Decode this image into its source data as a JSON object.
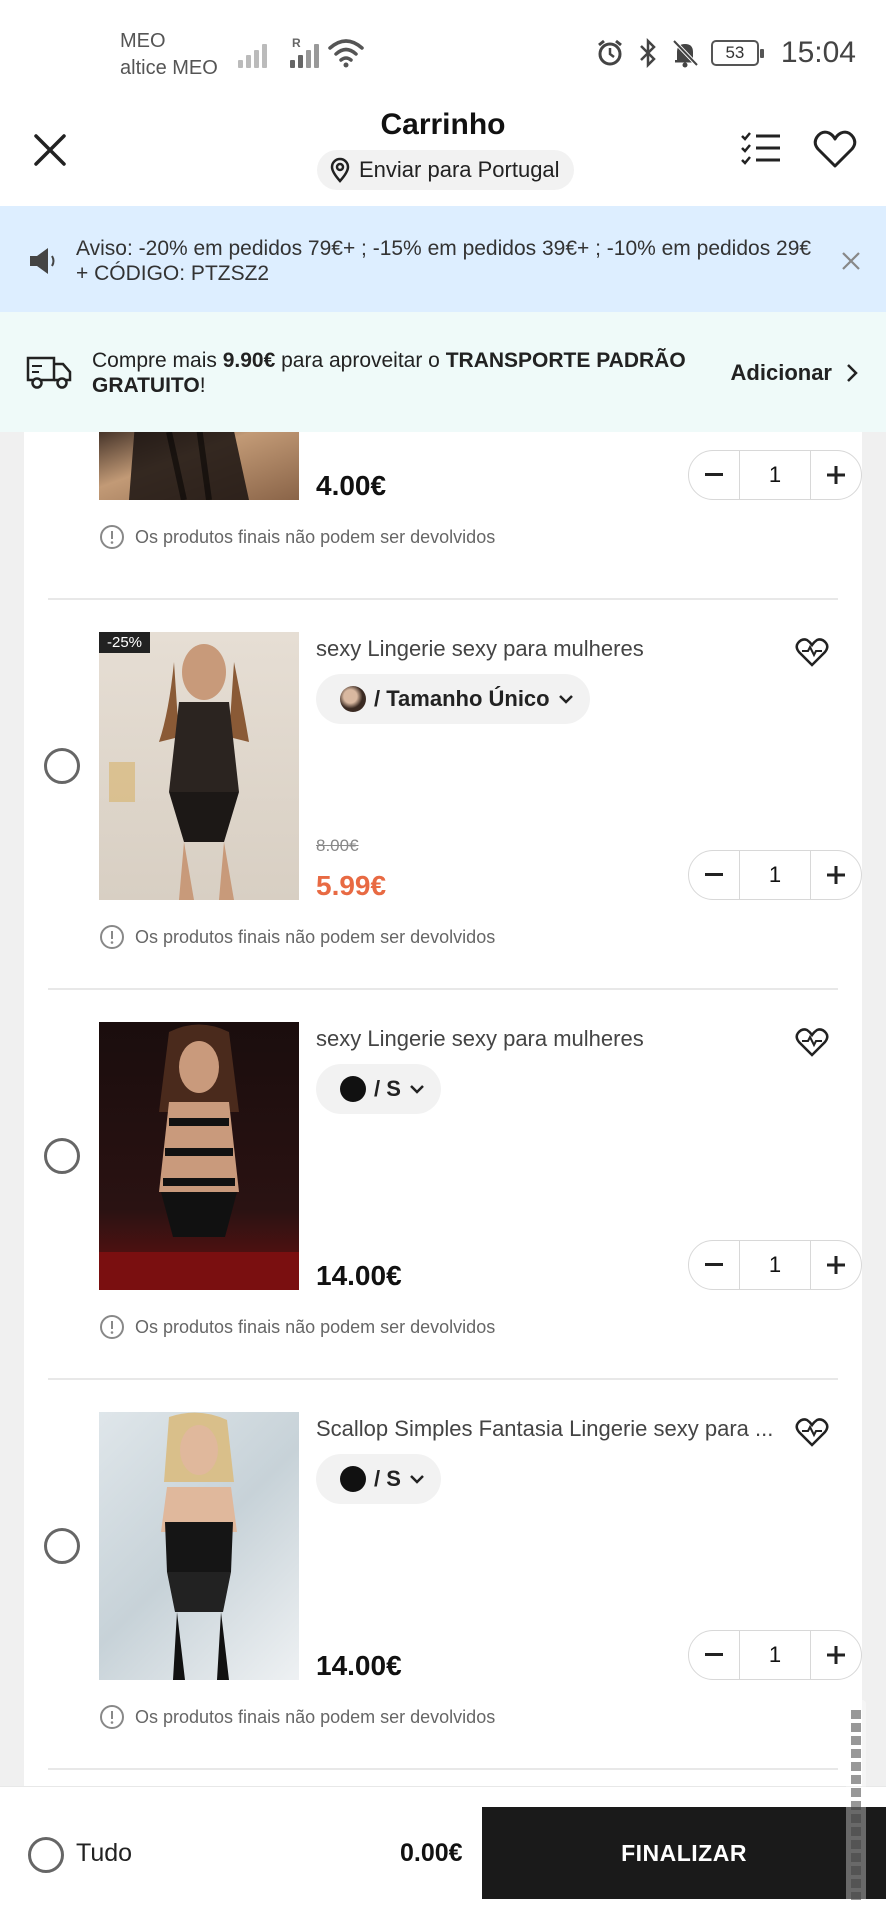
{
  "status_bar": {
    "carrier_line1": "MEO",
    "carrier_line2": "altice MEO",
    "roaming": "R",
    "battery": "53",
    "time": "15:04",
    "icons": [
      "signal-icon",
      "wifi-icon",
      "alarm-icon",
      "bluetooth-icon",
      "bell-muted-icon",
      "battery-icon"
    ]
  },
  "header": {
    "title": "Carrinho",
    "ship_to": "Enviar para Portugal",
    "icons": [
      "close-icon",
      "location-pin-icon",
      "checklist-icon",
      "heart-icon"
    ]
  },
  "notice": {
    "text": "Aviso: -20% em pedidos 79€+ ; -15% em pedidos 39€+ ; -10% em pedidos 29€+ CÓDIGO: PTZSZ2"
  },
  "free_shipping": {
    "prefix": "Compre mais ",
    "amount": "9.90€",
    "middle": " para aproveitar o ",
    "highlight": "TRANSPORTE PADRÃO GRATUITO",
    "suffix": "!",
    "action": "Adicionar"
  },
  "items": [
    {
      "title": "",
      "variant": "",
      "old_price": "",
      "price": "4.00€",
      "qty": "1",
      "note": "Os produtos finais não podem ser devolvidos"
    },
    {
      "badge": "-25%",
      "title": "sexy Lingerie sexy para mulheres",
      "variant": "/ Tamanho Único",
      "old_price": "8.00€",
      "price": "5.99€",
      "qty": "1",
      "note": "Os produtos finais não podem ser devolvidos"
    },
    {
      "title": "sexy Lingerie sexy para mulheres",
      "variant": "/ S",
      "old_price": "",
      "price": "14.00€",
      "qty": "1",
      "note": "Os produtos finais não podem ser devolvidos"
    },
    {
      "title": "Scallop Simples Fantasia Lingerie sexy para ...",
      "variant": "/ S",
      "old_price": "",
      "price": "14.00€",
      "qty": "1",
      "note": "Os produtos finais não podem ser devolvidos"
    }
  ],
  "bottom_bar": {
    "select_all": "Tudo",
    "total": "0.00€",
    "checkout": "FINALIZAR"
  },
  "colors": {
    "notice_bg": "#ddeeff",
    "freeship_bg": "#effaf9",
    "sale_price": "#e86a43",
    "checkout_bg": "#1a1a1a"
  }
}
